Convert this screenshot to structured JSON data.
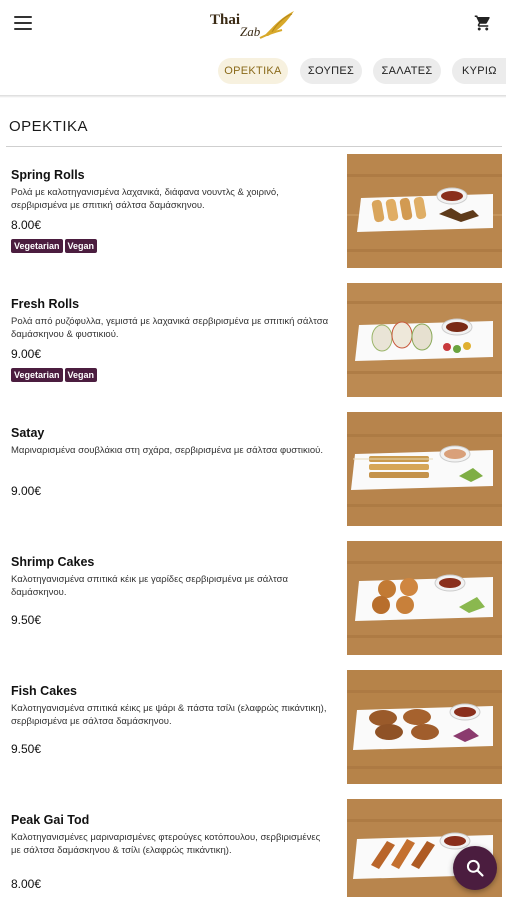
{
  "header": {
    "logo_text_1": "Thai",
    "logo_text_2": "Zab",
    "menu_icon": "hamburger-icon",
    "cart_icon": "cart-icon"
  },
  "tabs": [
    {
      "label": "ΟΡΕΚΤΙΚΑ",
      "active": true
    },
    {
      "label": "ΣΟΥΠΕΣ",
      "active": false
    },
    {
      "label": "ΣΑΛΑΤΕΣ",
      "active": false
    },
    {
      "label": "ΚΥΡΙΩ",
      "active": false
    }
  ],
  "section": {
    "title": "ΟΡΕΚΤΙΚΑ"
  },
  "items": [
    {
      "name": "Spring Rolls",
      "description": "Ρολά με καλοτηγανισμένα λαχανικά, διάφανα νουντλς & χοιρινό, σερβιρισμένα με σπιτική σάλτσα δαμάσκηνου.",
      "price": "8.00€",
      "tags": [
        "Vegetarian",
        "Vegan"
      ]
    },
    {
      "name": "Fresh Rolls",
      "description": "Ρολά από ρυζόφυλλα, γεμιστά με λαχανικά σερβιρισμένα με σπιτική σάλτσα δαμάσκηνου & φυστικιού.",
      "price": "9.00€",
      "tags": [
        "Vegetarian",
        "Vegan"
      ]
    },
    {
      "name": "Satay",
      "description": "Μαριναρισμένα σουβλάκια στη σχάρα, σερβιρισμένα με σάλτσα φυστικιού.",
      "price": "9.00€",
      "tags": []
    },
    {
      "name": "Shrimp Cakes",
      "description": "Καλοτηγανισμένα σπιτικά κέικ με γαρίδες σερβιρισμένα με σάλτσα δαμάσκηνου.",
      "price": "9.50€",
      "tags": []
    },
    {
      "name": "Fish Cakes",
      "description": "Καλοτηγανισμένα σπιτικά κέικς με ψάρι & πάστα τσίλι (ελαφρώς πικάντικη), σερβιρισμένα με σάλτσα δαμάσκηνου.",
      "price": "9.50€",
      "tags": []
    },
    {
      "name": "Peak Gai Tod",
      "description": "Καλοτηγανισμένες μαριναρισμένες φτερούγες κοτόπουλου, σερβιρισμένες με σάλτσα δαμάσκηνου & τσίλι (ελαφρώς πικάντικη).",
      "price": "8.00€",
      "tags": []
    }
  ],
  "fab": {
    "icon": "search-icon"
  },
  "colors": {
    "accent": "#4b1d3f",
    "active_tab_bg": "#f7f1df",
    "active_tab_text": "#8a6a1a"
  }
}
